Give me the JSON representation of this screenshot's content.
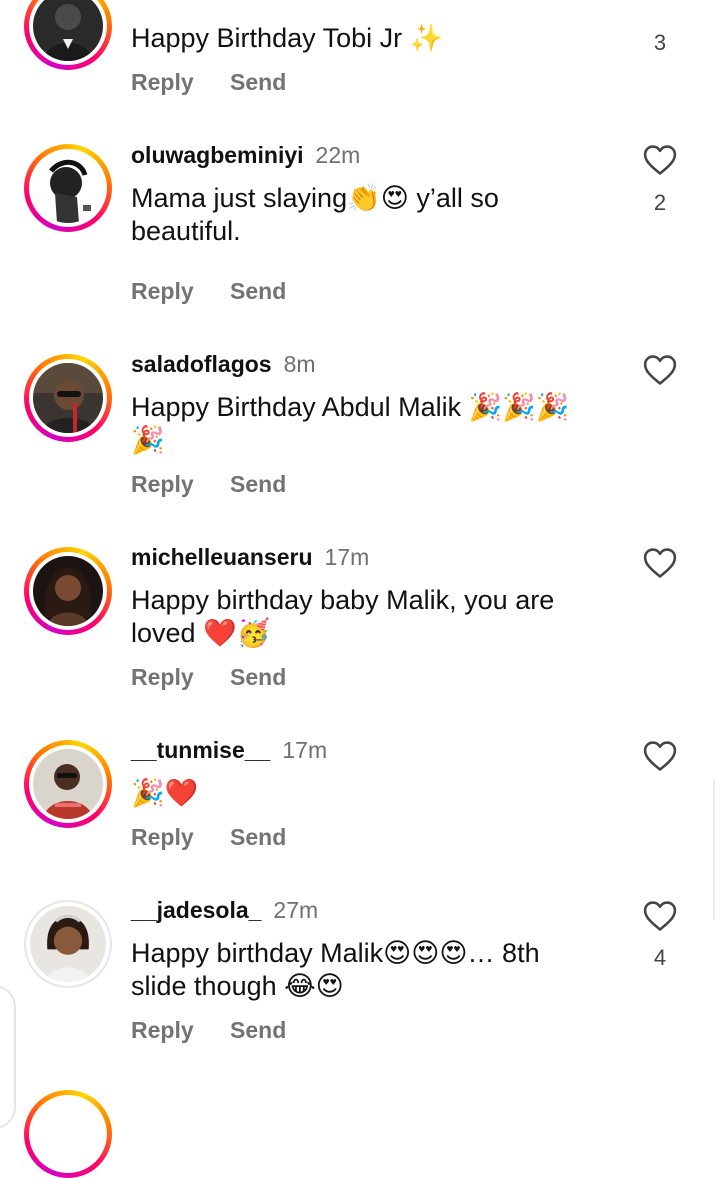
{
  "actions": {
    "reply": "Reply",
    "send": "Send"
  },
  "comments": [
    {
      "username": "",
      "time": "",
      "text": "Happy Birthday Tobi Jr ✨",
      "likes": "3"
    },
    {
      "username": "oluwagbeminiyi",
      "time": "22m",
      "text": "Mama just slaying👏😍 y’all so beautiful.",
      "likes": "2"
    },
    {
      "username": "saladoflagos",
      "time": "8m",
      "text": "Happy Birthday Abdul Malik 🎉🎉🎉🎉",
      "likes": ""
    },
    {
      "username": "michelleuanseru",
      "time": "17m",
      "text": "Happy birthday baby Malik, you are loved ❤️🥳",
      "likes": ""
    },
    {
      "username": "__tunmise__",
      "time": "17m",
      "text": "🎉❤️",
      "likes": ""
    },
    {
      "username": "__jadesola_",
      "time": "27m",
      "text": "Happy birthday Malik😍😍😍… 8th slide though 😂😍",
      "likes": "4"
    }
  ],
  "icons": {
    "like": "heart-outline-icon"
  },
  "colors": {
    "ring_start": "#d300c5",
    "ring_mid": "#ff0069",
    "ring_end": "#ffd600",
    "muted": "#737373"
  }
}
